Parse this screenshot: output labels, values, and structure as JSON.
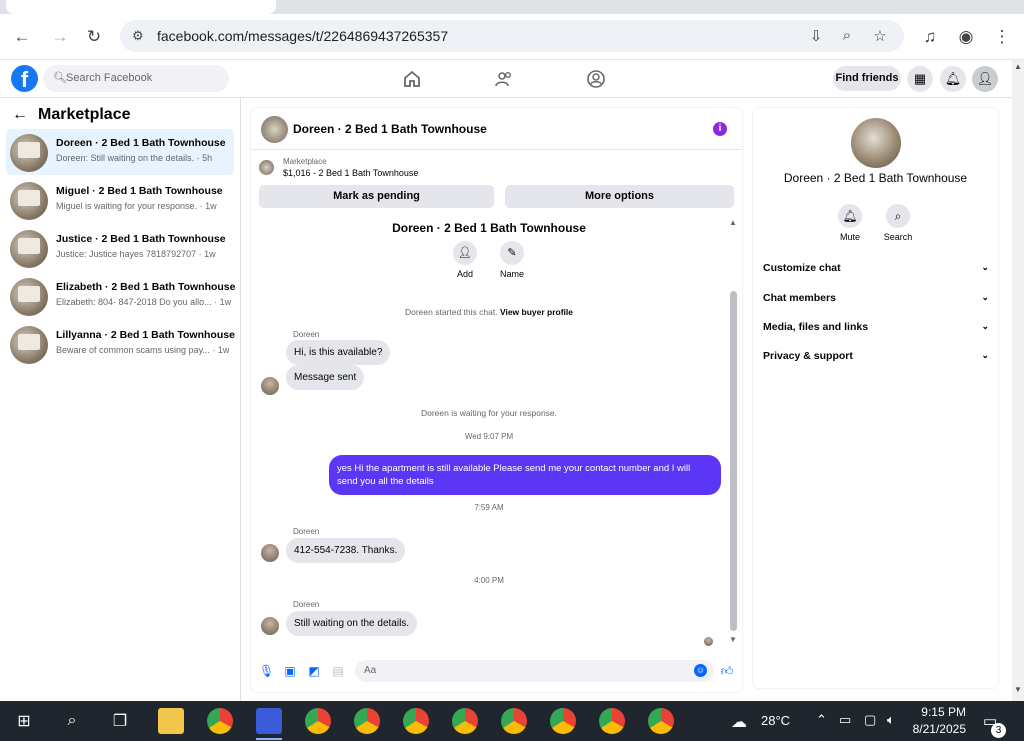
{
  "browser": {
    "url": "facebook.com/messages/t/2264869437265357"
  },
  "fb": {
    "search_placeholder": "Search Facebook",
    "find_friends": "Find friends"
  },
  "left": {
    "title": "Marketplace",
    "conversations": [
      {
        "title": "Doreen · 2 Bed 1 Bath Townhouse",
        "sub": "Doreen: Still waiting on the details. · 5h"
      },
      {
        "title": "Miguel · 2 Bed 1 Bath Townhouse",
        "sub": "Miguel is waiting for your response. · 1w"
      },
      {
        "title": "Justice · 2 Bed 1 Bath Townhouse",
        "sub": "Justice: Justice hayes 7818792707 · 1w"
      },
      {
        "title": "Elizabeth · 2 Bed 1 Bath Townhouse",
        "sub": "Elizabeth: 804- 847-2018 Do you allo... · 1w"
      },
      {
        "title": "Lillyanna · 2 Bed 1 Bath Townhouse",
        "sub": "Beware of common scams using pay... · 1w"
      }
    ]
  },
  "chat": {
    "header_name": "Doreen · 2 Bed 1 Bath Townhouse",
    "marketplace_label": "Marketplace",
    "listing": "$1,016 - 2 Bed 1 Bath Townhouse",
    "mark_pending": "Mark as pending",
    "more_options": "More options",
    "top_name": "Doreen · 2 Bed 1 Bath Townhouse",
    "add_label": "Add",
    "name_label": "Name",
    "started_text": "Doreen started this chat.",
    "view_profile": "View buyer profile",
    "sender": "Doreen",
    "msg1": "Hi, is this available?",
    "msg2": "Message sent",
    "waiting": "Doreen is waiting for your response.",
    "time1": "Wed 9:07 PM",
    "reply": "yes Hi the apartment is still available Please send me your contact number and I will send you all the details",
    "time2": "7:59 AM",
    "msg3": "412-554-7238. Thanks.",
    "time3": "4:00 PM",
    "msg4": "Still waiting on the details.",
    "composer_placeholder": "Aa"
  },
  "right": {
    "name": "Doreen · 2 Bed 1 Bath Townhouse",
    "mute": "Mute",
    "search": "Search",
    "rows": [
      "Customize chat",
      "Chat members",
      "Media, files and links",
      "Privacy & support"
    ]
  },
  "taskbar": {
    "temperature": "28°C",
    "time": "9:15 PM",
    "date": "8/21/2025",
    "notifications": "3"
  },
  "colors": {
    "accent": "#5b36f5",
    "fb_blue": "#1877f2"
  }
}
